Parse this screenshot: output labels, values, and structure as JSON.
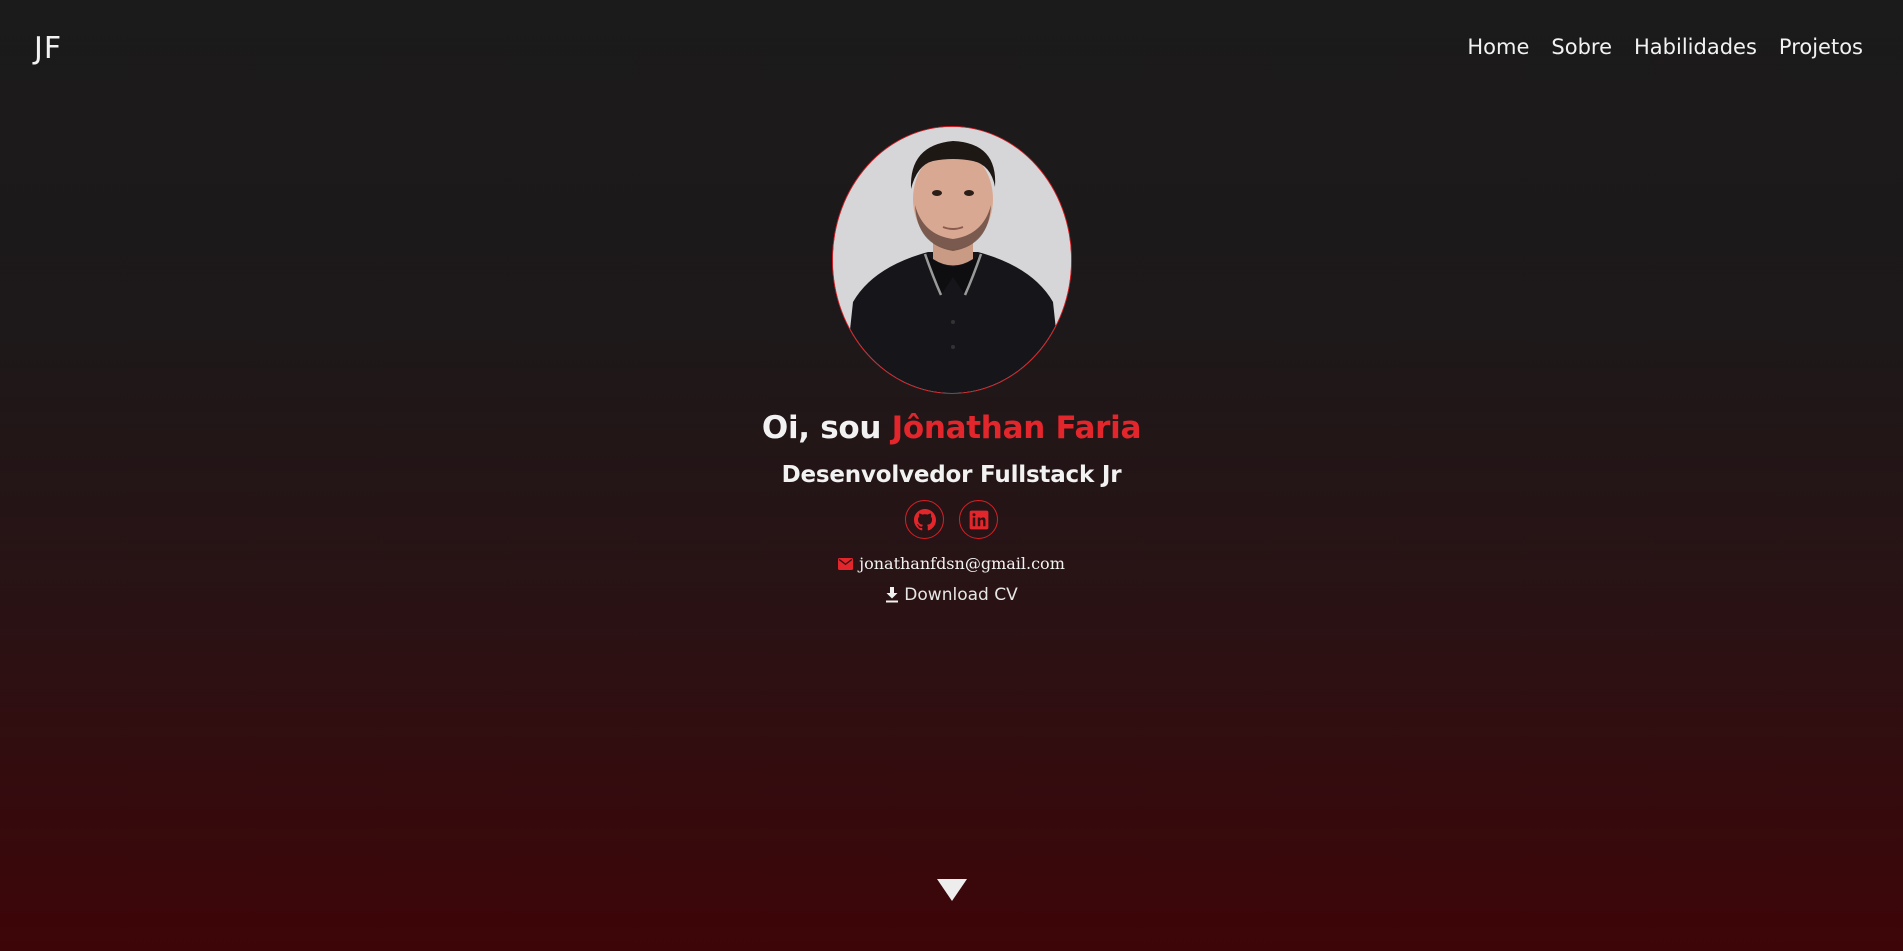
{
  "header": {
    "logo": "JF",
    "nav": [
      {
        "label": "Home"
      },
      {
        "label": "Sobre"
      },
      {
        "label": "Habilidades"
      },
      {
        "label": "Projetos"
      }
    ]
  },
  "hero": {
    "greeting_prefix": "Oi, sou ",
    "name": "Jônathan Faria",
    "role": "Desenvolvedor Fullstack Jr",
    "socials": [
      {
        "icon": "github-icon"
      },
      {
        "icon": "linkedin-icon"
      }
    ],
    "email_icon": "mail-icon",
    "email": "jonathanfdsn@gmail.com",
    "download_icon": "download-icon",
    "download_label": "Download CV"
  },
  "scroll_icon": "triangle-down-icon",
  "colors": {
    "accent": "#e3262c",
    "text": "#f2f2f2",
    "bg_top": "#1b1b1b",
    "bg_bottom": "#3e0508"
  }
}
